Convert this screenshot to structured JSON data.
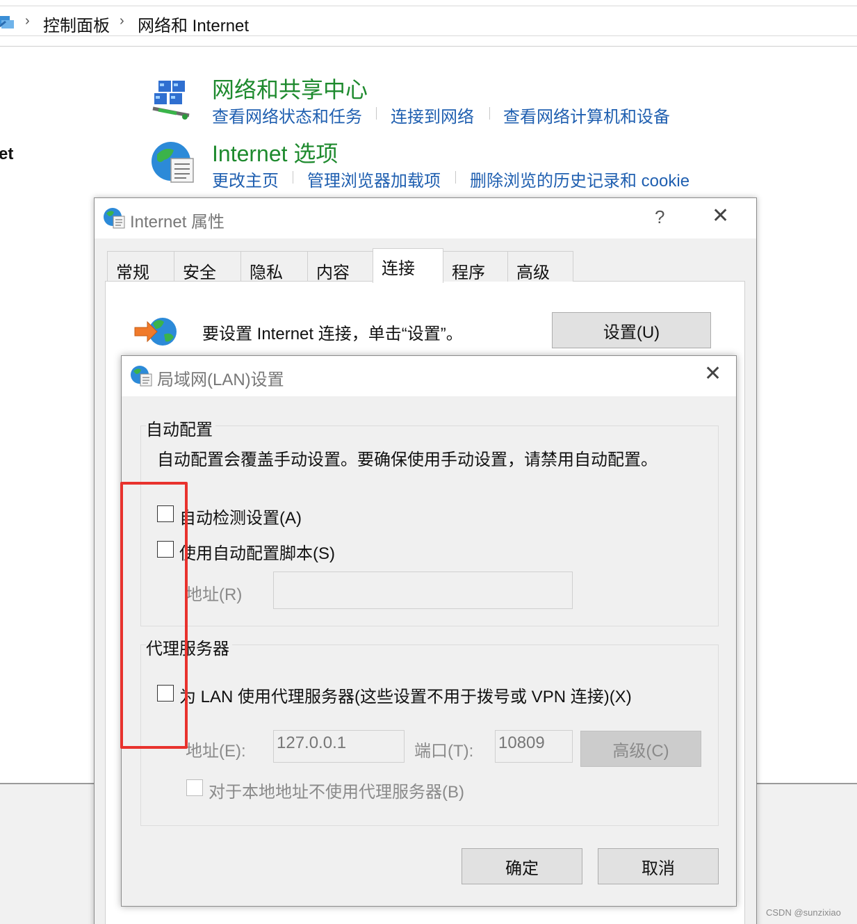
{
  "breadcrumb": {
    "items": [
      "控制面板",
      "网络和 Internet"
    ]
  },
  "left_fragment": "et",
  "categories": [
    {
      "title": "网络和共享中心",
      "links": [
        "查看网络状态和任务",
        "连接到网络",
        "查看网络计算机和设备"
      ]
    },
    {
      "title": "Internet 选项",
      "links": [
        "更改主页",
        "管理浏览器加载项",
        "删除浏览的历史记录和 cookie"
      ]
    }
  ],
  "props_dialog": {
    "title": "Internet 属性",
    "help": "?",
    "close": "✕",
    "tabs": [
      "常规",
      "安全",
      "隐私",
      "内容",
      "连接",
      "程序",
      "高级"
    ],
    "active_tab": "连接",
    "setup_text": "要设置 Internet 连接，单击“设置”。",
    "setup_button": "设置(U)"
  },
  "lan_dialog": {
    "title": "局域网(LAN)设置",
    "close": "✕",
    "auto_config": {
      "label": "自动配置",
      "description": "自动配置会覆盖手动设置。要确保使用手动设置，请禁用自动配置。",
      "auto_detect_label": "自动检测设置(A)",
      "auto_detect_checked": false,
      "script_label": "使用自动配置脚本(S)",
      "script_checked": false,
      "address_label": "地址(R)",
      "address_value": ""
    },
    "proxy": {
      "label": "代理服务器",
      "use_proxy_label": "为 LAN 使用代理服务器(这些设置不用于拨号或 VPN 连接)(X)",
      "use_proxy_checked": false,
      "address_label": "地址(E):",
      "address_value": "127.0.0.1",
      "port_label": "端口(T):",
      "port_value": "10809",
      "advanced_button": "高级(C)",
      "bypass_label": "对于本地地址不使用代理服务器(B)",
      "bypass_checked": false
    },
    "ok_button": "确定",
    "cancel_button": "取消"
  },
  "highlight_color": "#e8322d",
  "link_color": "#1f5fb0",
  "title_color": "#1e8a2e",
  "watermark": "CSDN @sunzixiao"
}
